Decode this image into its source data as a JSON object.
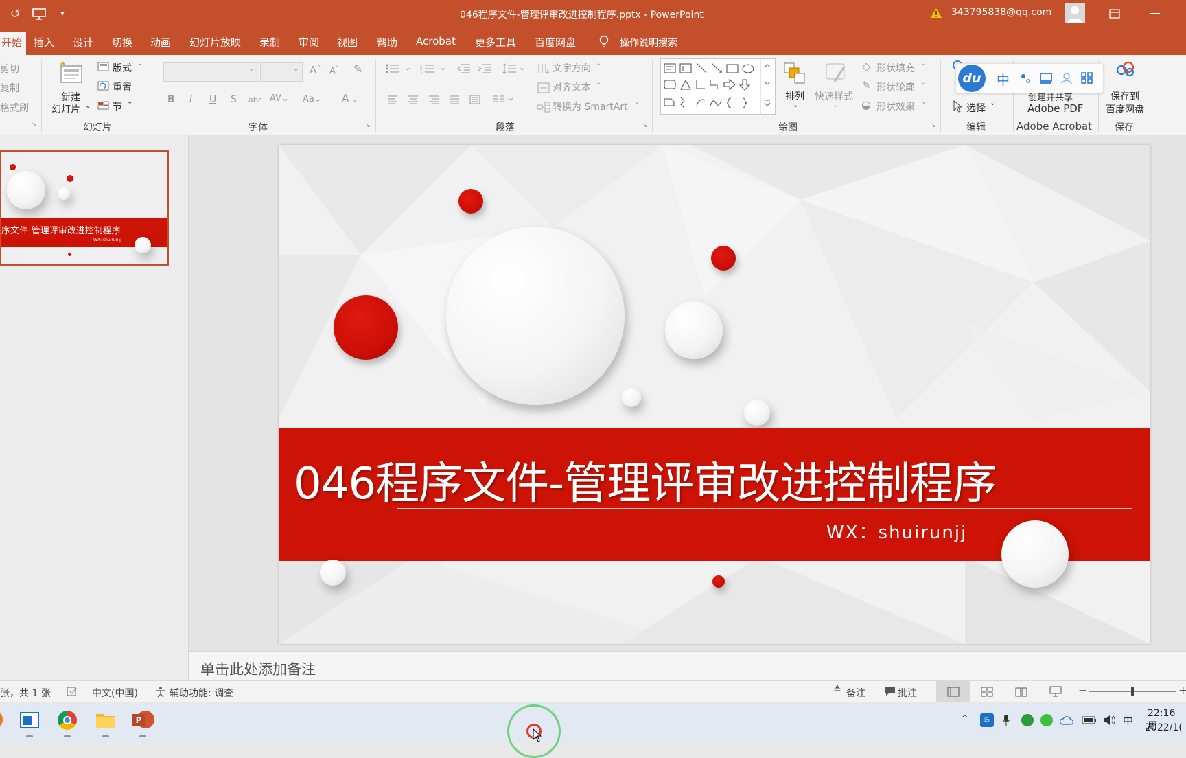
{
  "titlebar": {
    "title": "046程序文件-管理评审改进控制程序.pptx  -  PowerPoint",
    "account": "343795838@qq.com"
  },
  "tabs": [
    "开始",
    "插入",
    "设计",
    "切换",
    "动画",
    "幻灯片放映",
    "录制",
    "审阅",
    "视图",
    "帮助",
    "Acrobat",
    "更多工具",
    "百度网盘"
  ],
  "tell_me": "操作说明搜索",
  "ribbon": {
    "clipboard": {
      "cut": "剪切",
      "copy": "复制",
      "painter": "格式刷"
    },
    "slides": {
      "new_slide_1": "新建",
      "new_slide_2": "幻灯片",
      "layout": "版式",
      "reset": "重置",
      "section": "节",
      "label": "幻灯片"
    },
    "font": {
      "label": "字体"
    },
    "paragraph": {
      "text_direction": "文字方向",
      "align_text": "对齐文本",
      "smartart": "转换为 SmartArt",
      "label": "段落"
    },
    "drawing": {
      "arrange": "排列",
      "quick_styles": "快速样式",
      "fill": "形状填充",
      "outline": "形状轮廓",
      "effects": "形状效果",
      "label": "绘图"
    },
    "editing": {
      "select": "选择",
      "label": "编辑"
    },
    "acrobat": {
      "create_line1": "创建并共享",
      "create_line2": "Adobe PDF",
      "label": "Adobe Acrobat"
    },
    "save": {
      "line1": "保存到",
      "line2": "百度网盘",
      "label": "保存"
    }
  },
  "ime_toolbar": {
    "logo": "du",
    "mode": "中"
  },
  "thumbnail": {
    "title": "序文件-管理评审改进控制程序",
    "sub": "WX: shuirunjj"
  },
  "slide": {
    "title": "046程序文件-管理评审改进控制程序",
    "subtitle": "WX：shuirunjj",
    "accent_color": "#cc1305"
  },
  "notes_placeholder": "单击此处添加备注",
  "status": {
    "slide_count": "张，共 1 张",
    "language": "中文(中国)",
    "accessibility": "辅助功能: 调查",
    "notes": "备注",
    "comments": "批注"
  },
  "taskbar": {
    "time": "22:16 周",
    "date": "2022/1("
  }
}
